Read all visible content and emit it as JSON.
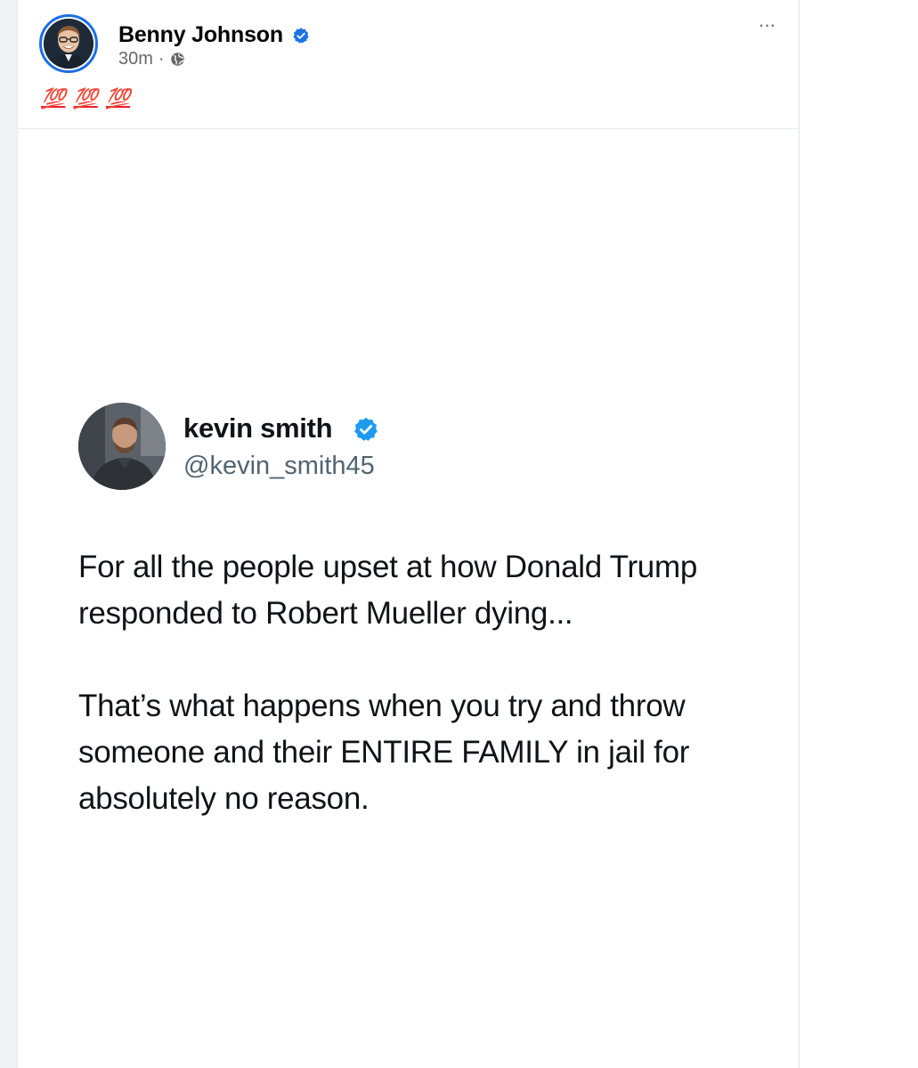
{
  "post": {
    "author_name": "Benny Johnson",
    "time": "30m",
    "separator": "·",
    "more_label": "···",
    "caption": [
      "💯",
      "💯",
      "💯"
    ],
    "caption_color": "#e8202a"
  },
  "tweet": {
    "name": "kevin smith",
    "handle": "@kevin_smith45",
    "paragraphs": [
      "For all the people upset at how Donald Trump responded to Robert Mueller dying...",
      "That’s what happens when you try and throw someone and their ENTIRE FAMILY in jail for absolutely no reason."
    ]
  },
  "colors": {
    "verified": "#1b74e4",
    "accent_ring": "#1b6ee5"
  },
  "icons": {
    "verified": "verified-badge-icon",
    "globe": "globe-icon",
    "more": "more-options-icon"
  }
}
